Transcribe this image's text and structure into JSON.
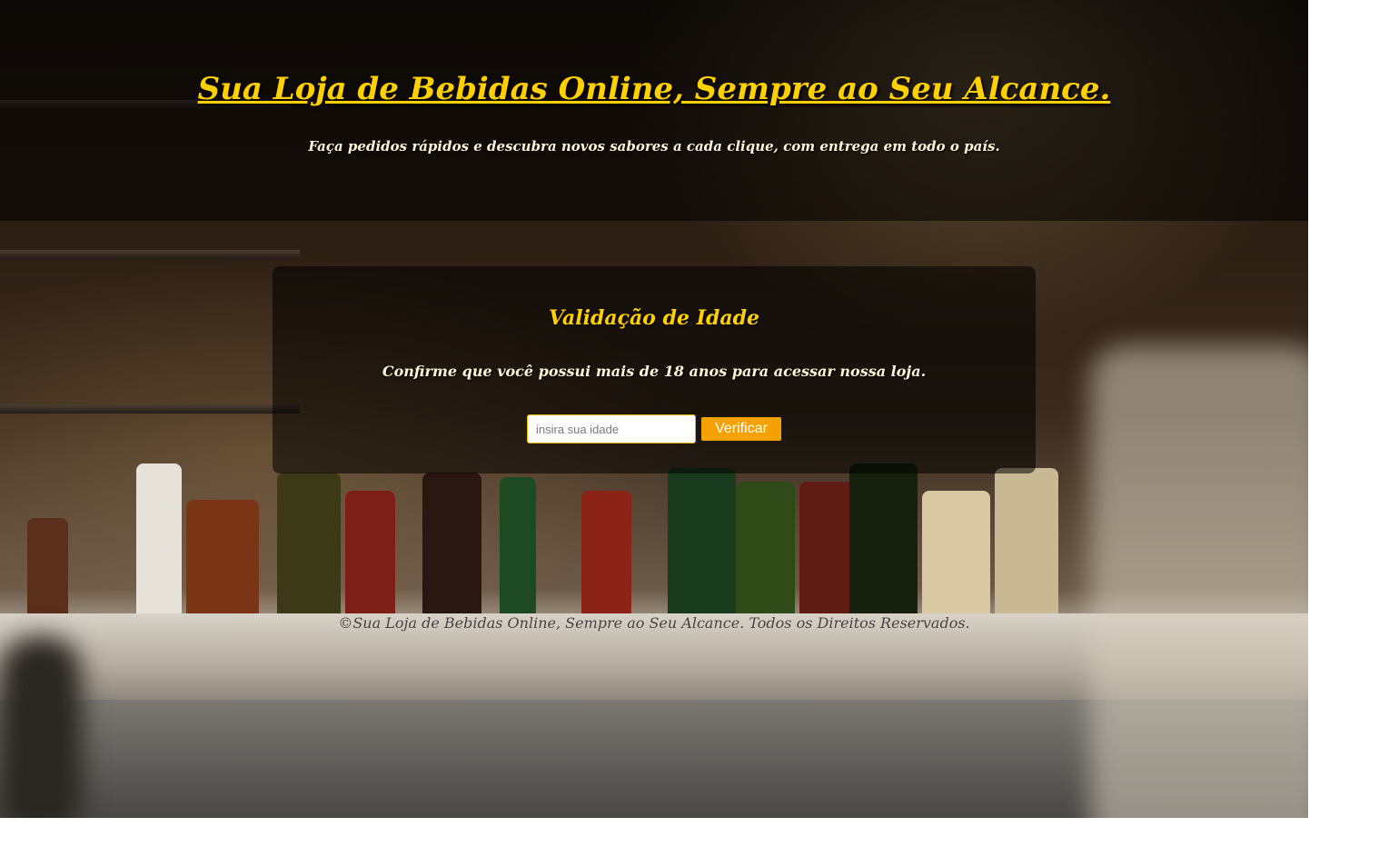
{
  "header": {
    "title": "Sua Loja de Bebidas Online, Sempre ao Seu Alcance.",
    "subtitle": "Faça pedidos rápidos e descubra novos sabores a cada clique, com entrega em todo o país."
  },
  "age_validation": {
    "title": "Validação de Idade",
    "message": "Confirme que você possui mais de 18 anos para acessar nossa loja.",
    "input_placeholder": "insira sua idade",
    "input_value": "",
    "button_label": "Verificar"
  },
  "footer": {
    "text": "©Sua Loja de Bebidas Online, Sempre ao Seu Alcance. Todos os Direitos Reservados."
  },
  "colors": {
    "accent": "#ffd000",
    "button": "#f5a100"
  }
}
